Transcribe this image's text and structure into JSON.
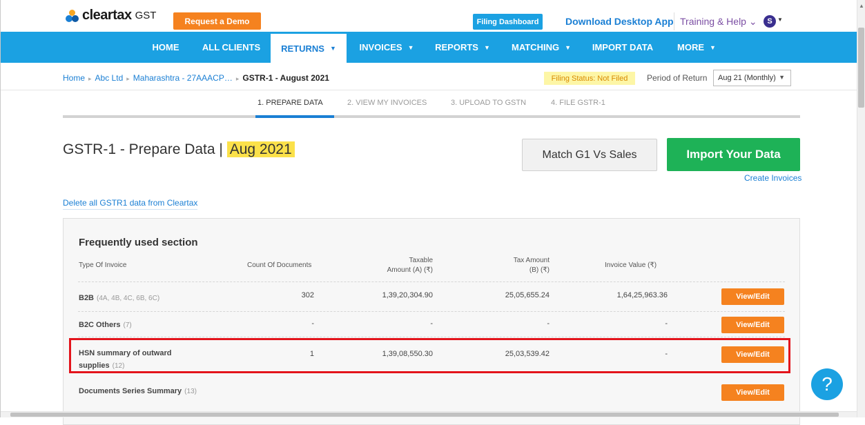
{
  "brand": {
    "name": "cleartax",
    "product": "GST"
  },
  "top": {
    "demo_button": "Request a Demo",
    "filing_dashboard": "Filing Dashboard",
    "download_app": "Download Desktop App",
    "training_help": "Training & Help ⌄",
    "avatar_initial": "S"
  },
  "nav": {
    "home": "HOME",
    "all_clients": "ALL CLIENTS",
    "returns": "RETURNS",
    "invoices": "INVOICES",
    "reports": "REPORTS",
    "matching": "MATCHING",
    "import_data": "IMPORT DATA",
    "more": "MORE"
  },
  "breadcrumb": {
    "home": "Home",
    "client": "Abc Ltd",
    "state": "Maharashtra - 27AAACP…",
    "current": "GSTR-1 - August 2021"
  },
  "filing_status": "Filing Status: Not Filed",
  "period": {
    "label": "Period of Return",
    "value": "Aug 21 (Monthly)"
  },
  "steps": [
    "1. PREPARE DATA",
    "2. VIEW MY INVOICES",
    "3. UPLOAD TO GSTN",
    "4. FILE GSTR-1"
  ],
  "page": {
    "title": "GSTR-1 - Prepare Data |",
    "title_highlight": "Aug 2021",
    "match_button": "Match G1 Vs Sales",
    "import_button": "Import Your Data",
    "create_invoices": "Create Invoices",
    "delete_link": "Delete all GSTR1 data from Cleartax"
  },
  "section": {
    "title": "Frequently used section",
    "headers": {
      "type": "Type Of Invoice",
      "count": "Count Of Documents",
      "taxable_1": "Taxable",
      "taxable_2": "Amount (A) (₹)",
      "tax_1": "Tax Amount",
      "tax_2": "(B) (₹)",
      "invoice_value": "Invoice Value (₹)"
    },
    "rows": [
      {
        "type": "B2B",
        "sub": "(4A, 4B, 4C, 6B, 6C)",
        "count": "302",
        "taxable": "1,39,20,304.90",
        "tax": "25,05,655.24",
        "value": "1,64,25,963.36",
        "action": "View/Edit"
      },
      {
        "type": "B2C Others",
        "sub": "(7)",
        "count": "-",
        "taxable": "-",
        "tax": "-",
        "value": "-",
        "action": "View/Edit"
      },
      {
        "type_line1": "HSN summary of outward",
        "type_line2": "supplies",
        "sub": "(12)",
        "count": "1",
        "taxable": "1,39,08,550.30",
        "tax": "25,03,539.42",
        "value": "-",
        "action": "View/Edit"
      },
      {
        "type": "Documents Series Summary",
        "sub": "(13)",
        "action": "View/Edit"
      }
    ]
  },
  "help_icon": "?"
}
